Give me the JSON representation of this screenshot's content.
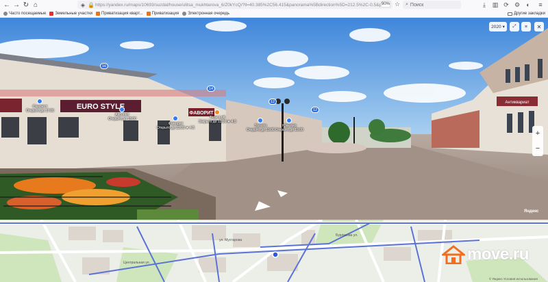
{
  "browser": {
    "url": "https://yandex.ru/maps/10693/suzdal/house/ulitsa_mukhtarova_6/Z0kYcQ/?ll=40.385%2C56.415&panorama%5Bdirection%5D=212.5%2C-0.5&panorama%5Bfull%5D=true",
    "zoom": "90%",
    "search_placeholder": "Поиск",
    "bookmarks": [
      {
        "label": "Часто посещаемые",
        "icon": "globe-icon"
      },
      {
        "label": "Земельные участки",
        "icon": "bookmark-red-icon"
      },
      {
        "label": "Приватизация кварт...",
        "icon": "bookmark-red-icon"
      },
      {
        "label": "Приватизация",
        "icon": "bookmark-red-icon"
      },
      {
        "label": "Электронная очередь",
        "icon": "globe-icon"
      }
    ],
    "other_bookmarks": "Другие закладки"
  },
  "panorama": {
    "year": "2020",
    "brand": "Яндекс",
    "shop_sign_left": "EURO STYLE",
    "shop_sign_mid": "ФАВОРИТ",
    "shop_sign_right": "Антиквариат",
    "pois": [
      {
        "name": "Санрест",
        "sub": "Открыто до 17:00"
      },
      {
        "name": "Аксонит",
        "sub": "Открыто до 18:00"
      },
      {
        "name": "Фаворит",
        "sub": "Открыто до 22:00 ★ 4.5"
      },
      {
        "name": "Time Loft",
        "sub": "Закрыто до 12:00 ★ 4.0"
      },
      {
        "name": "Золото",
        "sub": "Открыто до 19:00"
      },
      {
        "name": "Ювелир",
        "sub": "Открыто до 19:00"
      }
    ],
    "badges": [
      "16",
      "14",
      "12",
      "12"
    ]
  },
  "map": {
    "streets": [
      "ул. Мухтарова",
      "Бурлакова ул.",
      "Центральная ул."
    ],
    "copyright": "© Яндекс   Условия использования"
  },
  "watermark": {
    "text": "move.ru",
    "color": "#f26d1d"
  }
}
